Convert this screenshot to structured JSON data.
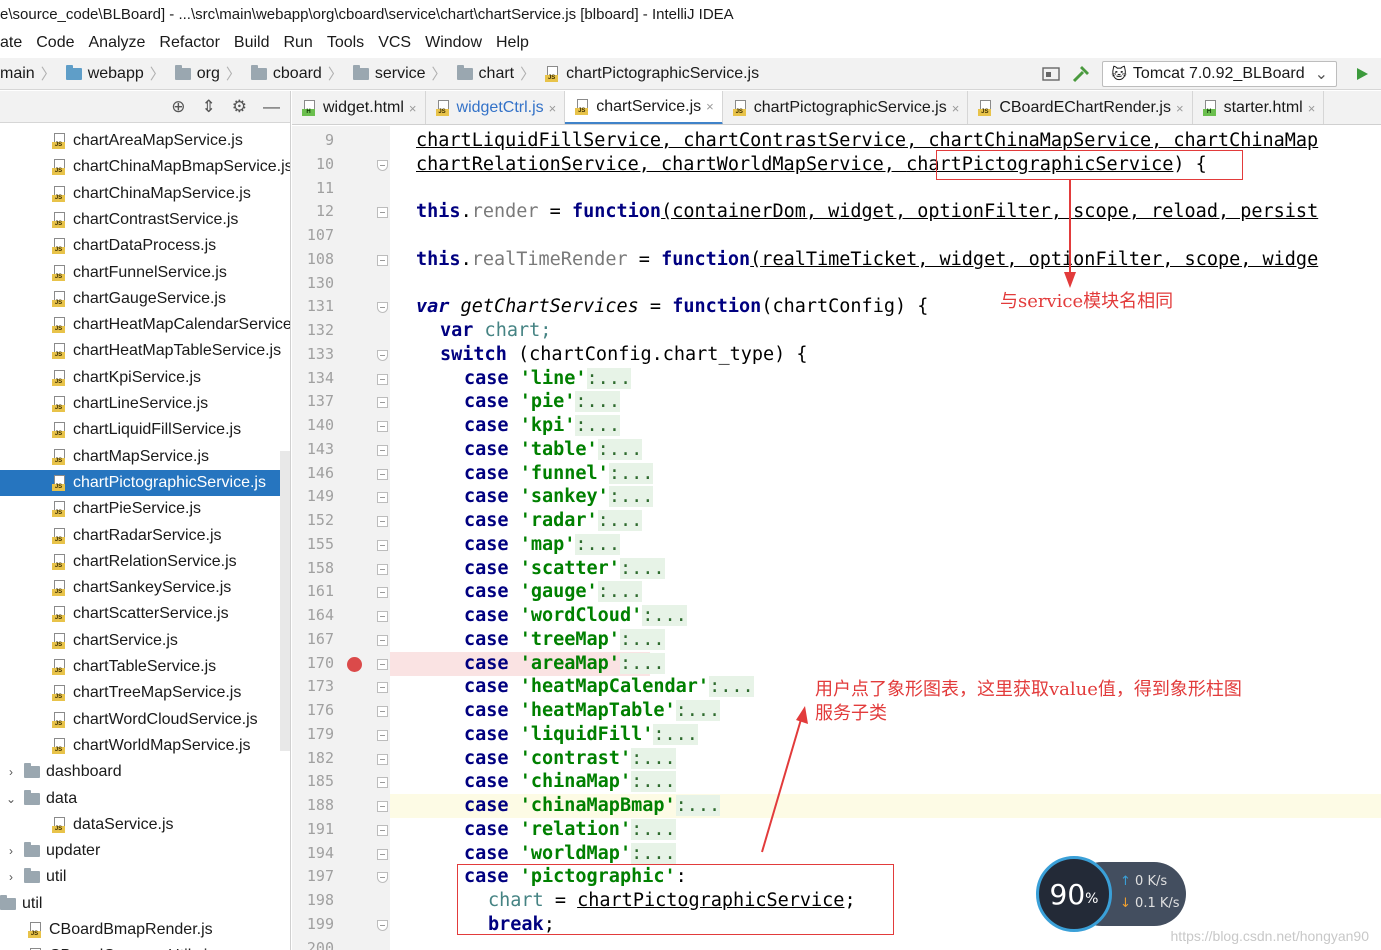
{
  "window": {
    "title": "e\\source_code\\BLBoard] - ...\\src\\main\\webapp\\org\\cboard\\service\\chart\\chartService.js [blboard] - IntelliJ IDEA"
  },
  "menu": [
    {
      "label": "ate",
      "name": "menu-navigate"
    },
    {
      "label": "Code",
      "name": "menu-code"
    },
    {
      "label": "Analyze",
      "name": "menu-analyze"
    },
    {
      "label": "Refactor",
      "name": "menu-refactor"
    },
    {
      "label": "Build",
      "name": "menu-build"
    },
    {
      "label": "Run",
      "name": "menu-run"
    },
    {
      "label": "Tools",
      "name": "menu-tools"
    },
    {
      "label": "VCS",
      "name": "menu-vcs"
    },
    {
      "label": "Window",
      "name": "menu-window"
    },
    {
      "label": "Help",
      "name": "menu-help"
    }
  ],
  "breadcrumb": [
    "main",
    "webapp",
    "org",
    "cboard",
    "service",
    "chart",
    "chartPictographicService.js"
  ],
  "run_config": {
    "label": "Tomcat 7.0.92_BLBoard"
  },
  "project_tree": [
    {
      "label": "chartAreaMapService.js",
      "type": "js"
    },
    {
      "label": "chartChinaMapBmapService.js",
      "type": "js"
    },
    {
      "label": "chartChinaMapService.js",
      "type": "js"
    },
    {
      "label": "chartContrastService.js",
      "type": "js"
    },
    {
      "label": "chartDataProcess.js",
      "type": "js"
    },
    {
      "label": "chartFunnelService.js",
      "type": "js"
    },
    {
      "label": "chartGaugeService.js",
      "type": "js"
    },
    {
      "label": "chartHeatMapCalendarService",
      "type": "js"
    },
    {
      "label": "chartHeatMapTableService.js",
      "type": "js"
    },
    {
      "label": "chartKpiService.js",
      "type": "js"
    },
    {
      "label": "chartLineService.js",
      "type": "js"
    },
    {
      "label": "chartLiquidFillService.js",
      "type": "js"
    },
    {
      "label": "chartMapService.js",
      "type": "js"
    },
    {
      "label": "chartPictographicService.js",
      "type": "js",
      "selected": true
    },
    {
      "label": "chartPieService.js",
      "type": "js"
    },
    {
      "label": "chartRadarService.js",
      "type": "js"
    },
    {
      "label": "chartRelationService.js",
      "type": "js"
    },
    {
      "label": "chartSankeyService.js",
      "type": "js"
    },
    {
      "label": "chartScatterService.js",
      "type": "js"
    },
    {
      "label": "chartService.js",
      "type": "js"
    },
    {
      "label": "chartTableService.js",
      "type": "js"
    },
    {
      "label": "chartTreeMapService.js",
      "type": "js"
    },
    {
      "label": "chartWordCloudService.js",
      "type": "js"
    },
    {
      "label": "chartWorldMapService.js",
      "type": "js"
    },
    {
      "label": "dashboard",
      "type": "folder",
      "arrow": "›"
    },
    {
      "label": "data",
      "type": "folder",
      "arrow": "⌄"
    },
    {
      "label": "dataService.js",
      "type": "js",
      "indent": 2
    },
    {
      "label": "updater",
      "type": "folder",
      "arrow": "›"
    },
    {
      "label": "util",
      "type": "folder",
      "arrow": "›"
    },
    {
      "label": "util",
      "type": "folder",
      "indent": 0,
      "arrow": ""
    },
    {
      "label": "CBoardBmapRender.js",
      "type": "js",
      "indent": 1
    },
    {
      "label": "CBoardCommonUtils.js",
      "type": "js",
      "indent": 1
    }
  ],
  "tabs": [
    {
      "label": "widget.html",
      "icon": "html"
    },
    {
      "label": "widgetCtrl.js",
      "icon": "js",
      "blue": true
    },
    {
      "label": "chartService.js",
      "icon": "js",
      "active": true
    },
    {
      "label": "chartPictographicService.js",
      "icon": "js"
    },
    {
      "label": "CBoardEChartRender.js",
      "icon": "js"
    },
    {
      "label": "starter.html",
      "icon": "html"
    }
  ],
  "gutter": [
    {
      "n": "9",
      "fold": ""
    },
    {
      "n": "10",
      "fold": "up"
    },
    {
      "n": "11",
      "fold": ""
    },
    {
      "n": "12",
      "fold": "box"
    },
    {
      "n": "107",
      "fold": ""
    },
    {
      "n": "108",
      "fold": "box"
    },
    {
      "n": "130",
      "fold": ""
    },
    {
      "n": "131",
      "fold": "up"
    },
    {
      "n": "132",
      "fold": ""
    },
    {
      "n": "133",
      "fold": "up"
    },
    {
      "n": "134",
      "fold": "box"
    },
    {
      "n": "137",
      "fold": "box"
    },
    {
      "n": "140",
      "fold": "box"
    },
    {
      "n": "143",
      "fold": "box"
    },
    {
      "n": "146",
      "fold": "box"
    },
    {
      "n": "149",
      "fold": "box"
    },
    {
      "n": "152",
      "fold": "box"
    },
    {
      "n": "155",
      "fold": "box"
    },
    {
      "n": "158",
      "fold": "box"
    },
    {
      "n": "161",
      "fold": "box"
    },
    {
      "n": "164",
      "fold": "box"
    },
    {
      "n": "167",
      "fold": "box"
    },
    {
      "n": "170",
      "fold": "box",
      "breakpoint": true
    },
    {
      "n": "173",
      "fold": "box"
    },
    {
      "n": "176",
      "fold": "box"
    },
    {
      "n": "179",
      "fold": "box"
    },
    {
      "n": "182",
      "fold": "box"
    },
    {
      "n": "185",
      "fold": "box"
    },
    {
      "n": "188",
      "fold": "box",
      "current": true
    },
    {
      "n": "191",
      "fold": "box"
    },
    {
      "n": "194",
      "fold": "box"
    },
    {
      "n": "197",
      "fold": "up"
    },
    {
      "n": "198",
      "fold": ""
    },
    {
      "n": "199",
      "fold": "up"
    },
    {
      "n": "200",
      "fold": ""
    }
  ],
  "code": {
    "l9": "chartLiquidFillService, chartContrastService, chartChinaMapService, chartChinaMap",
    "l10a": "chartRelationService, chartWorldMapService, ",
    "l10b": "chartPictographicService",
    "l10c": ") {",
    "l12": {
      "this": "this",
      "dot": ".",
      "prop": "render",
      "eq": " = ",
      "fn": "function",
      "args": "(containerDom, widget, optionFilter, scope, reload, persist"
    },
    "l108": {
      "this": "this",
      "dot": ".",
      "prop": "realTimeRender",
      "eq": " = ",
      "fn": "function",
      "args": "(realTimeTicket, widget, optionFilter, scope, widge"
    },
    "l131": {
      "var": "var",
      "name": " getChartServices",
      "eq": " = ",
      "fn": "function",
      "args": "(chartConfig) {"
    },
    "l132": {
      "var": "var",
      "name": " chart;"
    },
    "l133": {
      "kw": "switch",
      "rest": " (chartConfig.chart_type) {"
    },
    "cases": [
      "'line'",
      "'pie'",
      "'kpi'",
      "'table'",
      "'funnel'",
      "'sankey'",
      "'radar'",
      "'map'",
      "'scatter'",
      "'gauge'",
      "'wordCloud'",
      "'treeMap'",
      "'areaMap'",
      "'heatMapCalendar'",
      "'heatMapTable'",
      "'liquidFill'",
      "'contrast'",
      "'chinaMap'",
      "'chinaMapBmap'",
      "'relation'",
      "'worldMap'"
    ],
    "case_kw": "case",
    "colon_dots": ":...",
    "l197": {
      "kw": "case",
      "str": "'pictographic'",
      "rest": ":"
    },
    "l198": {
      "var": "chart",
      "eq": " = ",
      "val": "chartPictographicService",
      "end": ";"
    },
    "l199": {
      "kw": "break",
      "end": ";"
    }
  },
  "annotations": {
    "note1": "与service模块名相同",
    "note2a": "用户点了象形图表，这里获取value值，得到象形柱图",
    "note2b": "服务子类"
  },
  "network": {
    "percent": "90",
    "pct_sign": "%",
    "up": "0 K/s",
    "down": "0.1 K/s"
  },
  "watermark": "https://blog.csdn.net/hongyan90"
}
